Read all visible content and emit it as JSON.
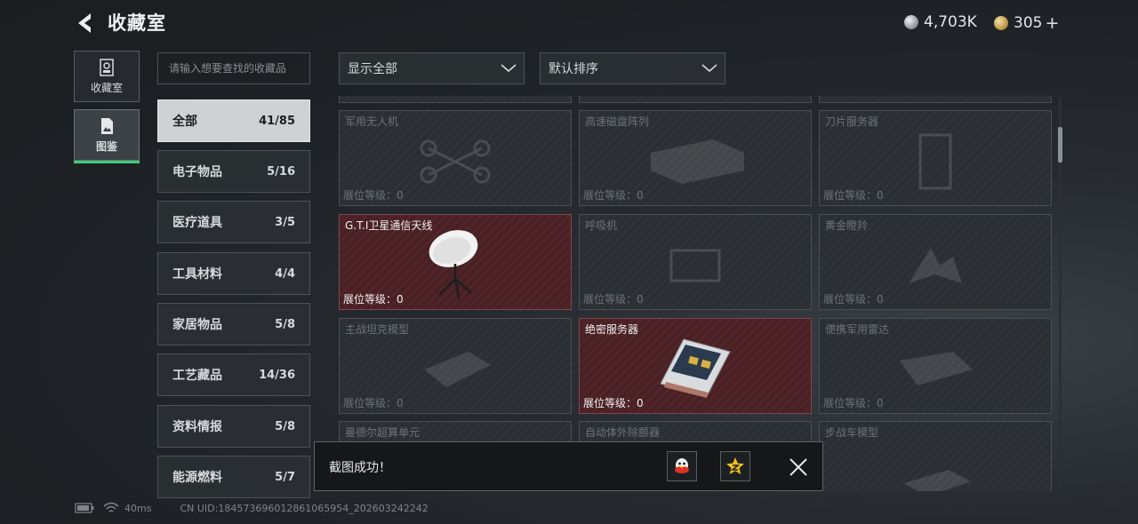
{
  "header": {
    "title": "收藏室",
    "currency_silver": "4,703K",
    "currency_gold": "305",
    "gold_add": "+"
  },
  "nav": [
    {
      "label": "收藏室",
      "icon": "collection-room-icon"
    },
    {
      "label": "图鉴",
      "icon": "catalog-icon"
    }
  ],
  "search": {
    "placeholder": "请输入想要查找的收藏品"
  },
  "categories": [
    {
      "label": "全部",
      "count": "41/85"
    },
    {
      "label": "电子物品",
      "count": "5/16"
    },
    {
      "label": "医疗道具",
      "count": "3/5"
    },
    {
      "label": "工具材料",
      "count": "4/4"
    },
    {
      "label": "家居物品",
      "count": "5/8"
    },
    {
      "label": "工艺藏品",
      "count": "14/36"
    },
    {
      "label": "资料情报",
      "count": "5/8"
    },
    {
      "label": "能源燃料",
      "count": "5/7"
    }
  ],
  "filters": {
    "display": "显示全部",
    "sort": "默认排序"
  },
  "items": [
    {
      "name": "军用无人机",
      "level": "展位等级：0",
      "owned": false,
      "icon": "drone-icon"
    },
    {
      "name": "高速磁盘阵列",
      "level": "展位等级：0",
      "owned": false,
      "icon": "disk-array-icon"
    },
    {
      "name": "刀片服务器",
      "level": "展位等级：0",
      "owned": false,
      "icon": "blade-server-icon"
    },
    {
      "name": "G.T.I卫星通信天线",
      "level": "展位等级：0",
      "owned": true,
      "icon": "satellite-dish-icon"
    },
    {
      "name": "呼吸机",
      "level": "展位等级：0",
      "owned": false,
      "icon": "ventilator-icon"
    },
    {
      "name": "黄金瞪羚",
      "level": "展位等级：0",
      "owned": false,
      "icon": "gazelle-icon"
    },
    {
      "name": "主战坦克模型",
      "level": "展位等级：0",
      "owned": false,
      "icon": "tank-model-icon"
    },
    {
      "name": "绝密服务器",
      "level": "展位等级：0",
      "owned": true,
      "icon": "server-icon"
    },
    {
      "name": "便携军用雷达",
      "level": "展位等级：0",
      "owned": false,
      "icon": "radar-icon"
    },
    {
      "name": "曼德尔超算单元",
      "level": "",
      "owned": false,
      "icon": "supercomputer-icon"
    },
    {
      "name": "自动体外除颤器",
      "level": "",
      "owned": false,
      "icon": "defibrillator-icon"
    },
    {
      "name": "步战车模型",
      "level": "",
      "owned": false,
      "icon": "ifv-model-icon"
    }
  ],
  "toast": {
    "message": "截图成功！"
  },
  "footer": {
    "ping": "40ms",
    "uid": "CN UID:18457369601286106595​4_202603242242"
  }
}
